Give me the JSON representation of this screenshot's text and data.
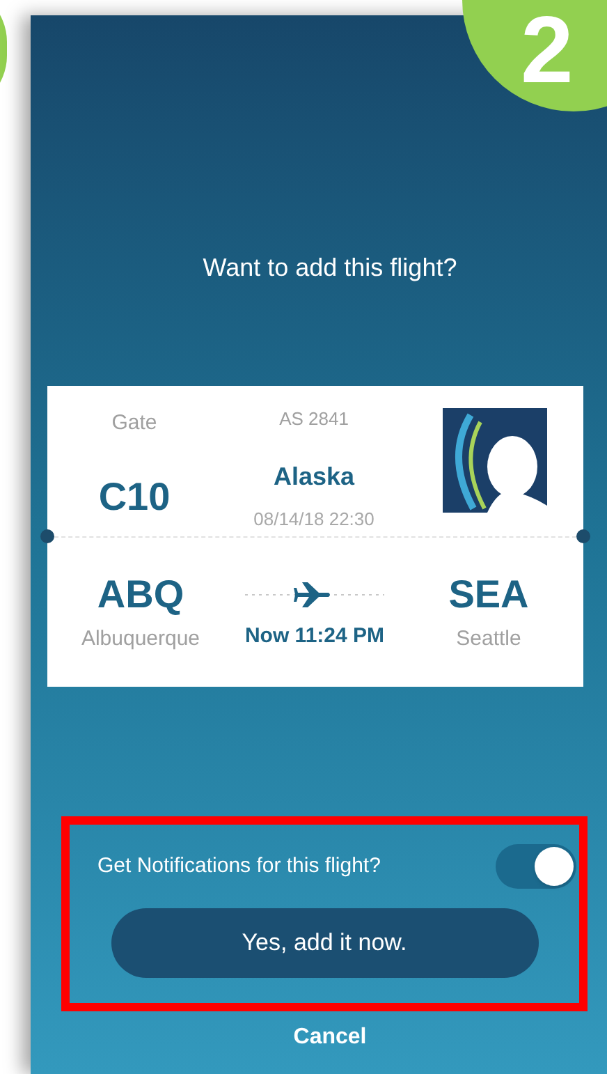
{
  "badge": {
    "number": "2"
  },
  "dialog": {
    "title": "Want to add this flight?"
  },
  "flight": {
    "gate_label": "Gate",
    "gate": "C10",
    "flight_number": "AS 2841",
    "airline": "Alaska",
    "scheduled": "08/14/18 22:30",
    "origin": {
      "code": "ABQ",
      "city": "Albuquerque"
    },
    "destination": {
      "code": "SEA",
      "city": "Seattle"
    },
    "status_time": "Now 11:24 PM"
  },
  "notifications": {
    "label": "Get Notifications for this flight?",
    "on": true
  },
  "buttons": {
    "confirm": "Yes, add it now.",
    "cancel": "Cancel"
  }
}
